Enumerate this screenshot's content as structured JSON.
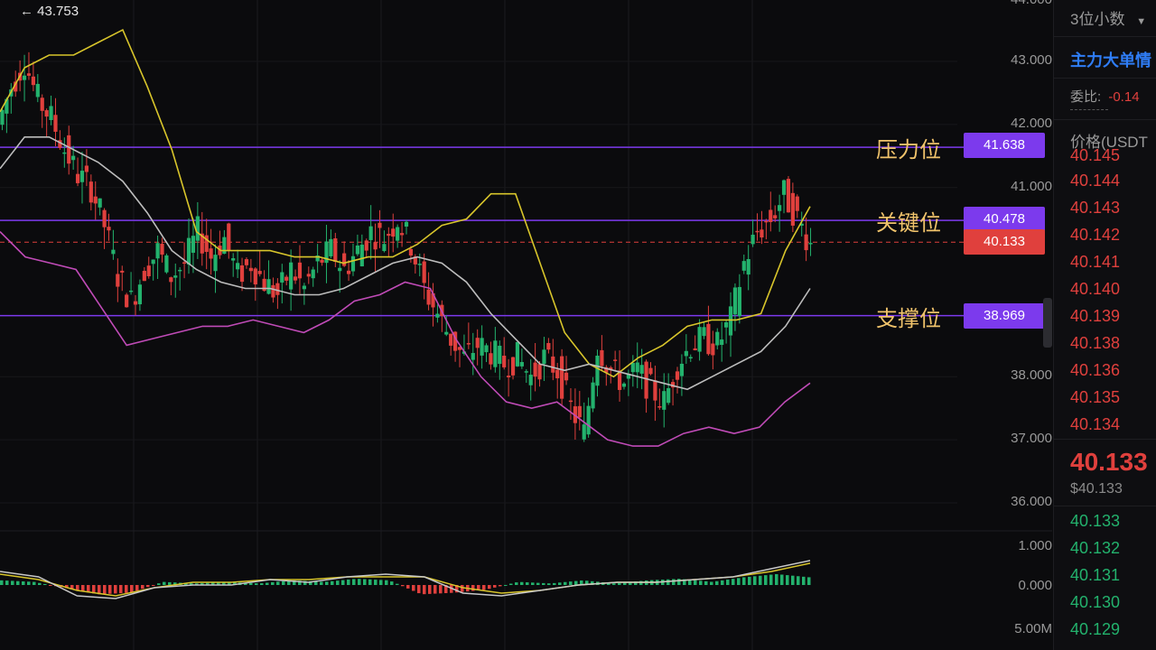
{
  "chart_data": {
    "type": "candlestick",
    "title": "",
    "y_axis": {
      "ticks": [
        "44.000",
        "43.000",
        "42.000",
        "41.000",
        "38.000",
        "37.000",
        "36.000"
      ],
      "tick_values": [
        44,
        43,
        42,
        41,
        38,
        37,
        36
      ],
      "range": [
        35.7,
        44.1
      ]
    },
    "indicator_axis": {
      "ticks": [
        "1.000",
        "0.000",
        "5.00M"
      ]
    },
    "high_marker": "← 43.753",
    "levels": [
      {
        "name": "压力位",
        "value": 41.638,
        "label": "41.638",
        "color": "#7c3aed"
      },
      {
        "name": "关键位",
        "value": 40.478,
        "label": "40.478",
        "color": "#7c3aed"
      },
      {
        "name": "支撑位",
        "value": 38.969,
        "label": "38.969",
        "color": "#7c3aed"
      }
    ],
    "last_price": {
      "value": 40.133,
      "label": "40.133",
      "color": "#e0403d"
    },
    "close_series": [
      42.0,
      42.6,
      43.0,
      42.4,
      42.1,
      41.6,
      41.2,
      41.0,
      40.4,
      39.6,
      39.2,
      39.7,
      40.0,
      39.6,
      39.8,
      40.3,
      39.9,
      40.2,
      39.6,
      39.8,
      39.5,
      39.3,
      39.7,
      39.4,
      39.8,
      40.0,
      39.7,
      40.0,
      40.3,
      40.2,
      40.5,
      40.1,
      39.4,
      39.0,
      38.6,
      38.3,
      38.5,
      38.4,
      38.2,
      38.3,
      38.0,
      38.3,
      38.1,
      37.5,
      37.1,
      38.5,
      38.1,
      37.9,
      38.1,
      37.8,
      37.6,
      38.2,
      38.5,
      38.6,
      38.5,
      38.9,
      39.8,
      40.3,
      40.5,
      40.9,
      40.5,
      40.1
    ],
    "bb_upper": [
      42.2,
      42.9,
      43.1,
      43.1,
      43.3,
      43.5,
      42.6,
      41.6,
      40.3,
      40.0,
      40.0,
      40.0,
      39.9,
      39.9,
      39.8,
      39.9,
      39.9,
      40.1,
      40.4,
      40.5,
      40.9,
      40.9,
      39.8,
      38.7,
      38.2,
      38.0,
      38.3,
      38.5,
      38.8,
      38.9,
      38.9,
      39.0,
      40.0,
      40.7
    ],
    "bb_middle": [
      41.3,
      41.8,
      41.8,
      41.6,
      41.4,
      41.1,
      40.6,
      40.0,
      39.7,
      39.5,
      39.4,
      39.4,
      39.3,
      39.3,
      39.4,
      39.6,
      39.8,
      39.9,
      39.8,
      39.5,
      39.0,
      38.6,
      38.2,
      38.1,
      38.2,
      38.1,
      38.0,
      37.9,
      37.8,
      38.0,
      38.2,
      38.4,
      38.8,
      39.4
    ],
    "bb_lower": [
      40.3,
      39.9,
      39.8,
      39.7,
      39.1,
      38.5,
      38.6,
      38.7,
      38.8,
      38.8,
      38.9,
      38.8,
      38.7,
      38.9,
      39.2,
      39.3,
      39.5,
      39.4,
      38.6,
      38.0,
      37.6,
      37.5,
      37.6,
      37.3,
      37.0,
      36.9,
      36.9,
      37.1,
      37.2,
      37.1,
      37.2,
      37.6,
      37.9
    ],
    "macd_hist": [
      0.3,
      0.2,
      -0.2,
      -0.6,
      -0.5,
      0.2,
      0.1,
      0.2,
      0.1,
      0.3,
      0.2,
      0.4,
      0.3,
      -0.6,
      -0.5,
      -0.3,
      0.2,
      0.1,
      0.3,
      0.1,
      0.3,
      0.4,
      0.2,
      0.5,
      0.7,
      0.5
    ],
    "dif": [
      0.5,
      0.3,
      -0.4,
      -0.5,
      -0.1,
      0.0,
      0.0,
      0.2,
      0.1,
      0.3,
      0.4,
      0.3,
      -0.3,
      -0.4,
      -0.2,
      0.0,
      0.1,
      0.1,
      0.2,
      0.3,
      0.6,
      0.9
    ],
    "dea": [
      0.4,
      0.2,
      -0.2,
      -0.4,
      -0.1,
      0.1,
      0.1,
      0.2,
      0.2,
      0.3,
      0.3,
      0.3,
      -0.1,
      -0.3,
      -0.2,
      0.0,
      0.1,
      0.1,
      0.2,
      0.3,
      0.5,
      0.8
    ]
  },
  "panel": {
    "precision_label": "3位小数",
    "dropdown_arrow": "▼",
    "title": "主力大单情",
    "ratio_label": "委比:",
    "ratio_value": "-0.14",
    "price_header": "价格(USDT",
    "asks": [
      "40.145",
      "40.144",
      "40.143",
      "40.142",
      "40.141",
      "40.140",
      "40.139",
      "40.138",
      "40.136",
      "40.135",
      "40.134"
    ],
    "last_price": "40.133",
    "last_price_usd": "$40.133",
    "bids": [
      "40.133",
      "40.132",
      "40.131",
      "40.130",
      "40.129"
    ],
    "ask_color": "#e0403d",
    "bid_color": "#23b26d",
    "accent_color": "#2f7df6"
  }
}
